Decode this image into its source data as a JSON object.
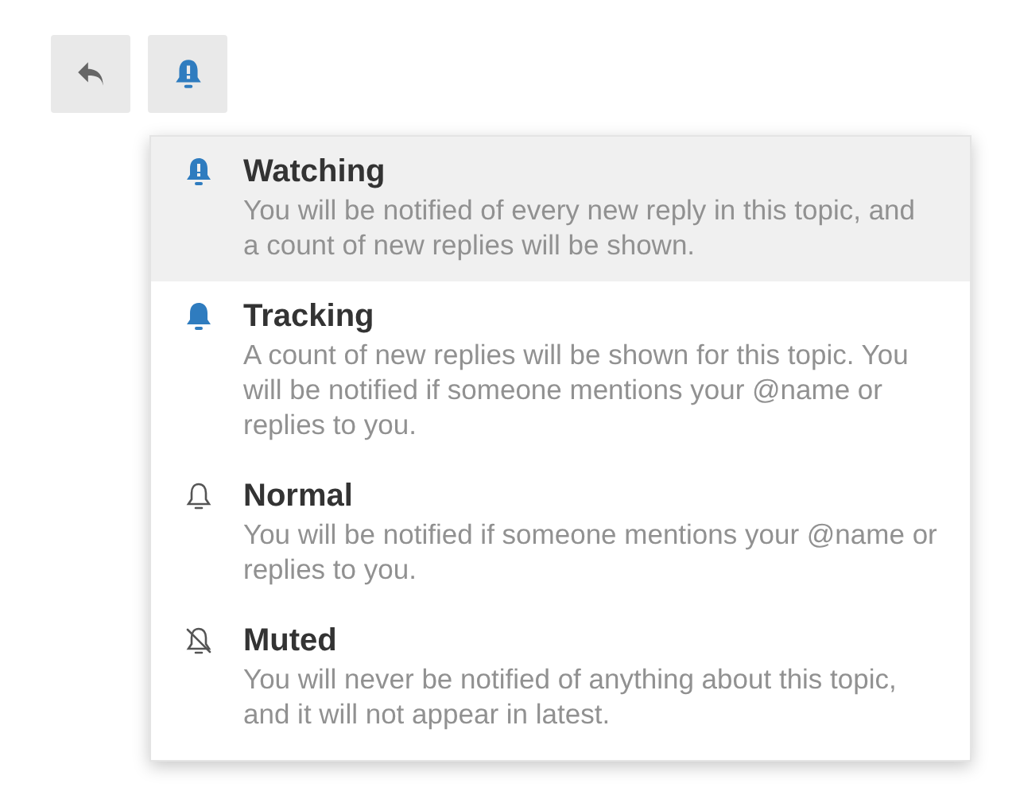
{
  "toolbar": [
    {
      "kind": "reply"
    },
    {
      "kind": "notifications"
    }
  ],
  "menu": {
    "items": [
      {
        "kind": "watching",
        "title": "Watching",
        "description": "You will be notified of every new reply in this topic, and a count of new replies will be shown.",
        "selected": true
      },
      {
        "kind": "tracking",
        "title": "Tracking",
        "description": "A count of new replies will be shown for this topic. You will be notified if someone mentions your @name or replies to you.",
        "selected": false
      },
      {
        "kind": "normal",
        "title": "Normal",
        "description": "You will be notified if someone mentions your @name or replies to you.",
        "selected": false
      },
      {
        "kind": "muted",
        "title": "Muted",
        "description": "You will never be notified of anything about this topic, and it will not appear in latest.",
        "selected": false
      }
    ]
  }
}
